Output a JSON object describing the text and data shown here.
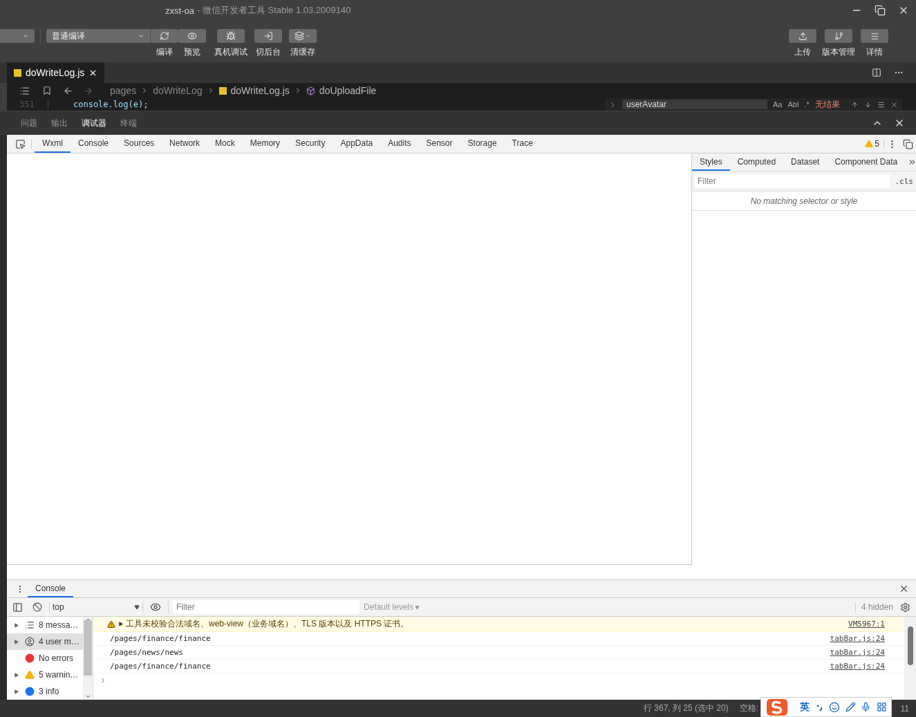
{
  "window": {
    "title": "zxst-oa",
    "subtitle": "- 微信开发者工具 Stable 1.03.2009140"
  },
  "toolbar": {
    "mode_select": "普通编译",
    "left_buttons": [
      {
        "label": "编译"
      },
      {
        "label": "预览"
      },
      {
        "label": "真机调试"
      },
      {
        "label": "切后台"
      },
      {
        "label": "清缓存"
      }
    ],
    "right_buttons": [
      {
        "label": "上传"
      },
      {
        "label": "版本管理"
      },
      {
        "label": "详情"
      }
    ]
  },
  "editor": {
    "tabs": [
      {
        "label": "doWriteLog.js",
        "selected": true
      }
    ],
    "breadcrumb": [
      "pages",
      "doWriteLog",
      "doWriteLog.js",
      "doUploadFile"
    ],
    "line_number": "351",
    "code": "console.log(e);",
    "find": {
      "value": "userAvatar",
      "options": [
        "Aa",
        "Abl",
        ".*"
      ],
      "result": "无结果"
    }
  },
  "panel_tabs": [
    {
      "label": "问题",
      "selected": false
    },
    {
      "label": "输出",
      "selected": false
    },
    {
      "label": "调试器",
      "selected": true
    },
    {
      "label": "终端",
      "selected": false
    }
  ],
  "devtools": {
    "tabs": [
      {
        "label": "Wxml",
        "selected": true
      },
      {
        "label": "Console",
        "selected": false
      },
      {
        "label": "Sources",
        "selected": false
      },
      {
        "label": "Network",
        "selected": false
      },
      {
        "label": "Mock",
        "selected": false
      },
      {
        "label": "Memory",
        "selected": false
      },
      {
        "label": "Security",
        "selected": false
      },
      {
        "label": "AppData",
        "selected": false
      },
      {
        "label": "Audits",
        "selected": false
      },
      {
        "label": "Sensor",
        "selected": false
      },
      {
        "label": "Storage",
        "selected": false
      },
      {
        "label": "Trace",
        "selected": false
      }
    ],
    "warning_count": "5"
  },
  "styles_pane": {
    "tabs": [
      {
        "label": "Styles",
        "selected": true
      },
      {
        "label": "Computed",
        "selected": false
      },
      {
        "label": "Dataset",
        "selected": false
      },
      {
        "label": "Component Data",
        "selected": false
      }
    ],
    "filter_placeholder": "Filter",
    "cls": ".cls",
    "empty": "No matching selector or style"
  },
  "console": {
    "tab": "Console",
    "context": "top",
    "filter_placeholder": "Filter",
    "levels": "Default levels",
    "hidden": "4 hidden",
    "sidebar": [
      {
        "kind": "messages",
        "label": "8 messa…",
        "selected": false
      },
      {
        "kind": "user",
        "label": "4 user m…",
        "selected": true
      },
      {
        "kind": "error",
        "label": "No errors",
        "selected": false
      },
      {
        "kind": "warning",
        "label": "5 warnin…",
        "selected": false
      },
      {
        "kind": "info",
        "label": "3 info",
        "selected": false
      }
    ],
    "messages": [
      {
        "kind": "warning",
        "text": "工具未校验合法域名、web-view（业务域名）、TLS 版本以及 HTTPS 证书。",
        "source": "VM5967:1"
      },
      {
        "kind": "log",
        "text": "/pages/finance/finance",
        "source": "tabBar.js:24"
      },
      {
        "kind": "log",
        "text": "/pages/news/news",
        "source": "tabBar.js:24"
      },
      {
        "kind": "log",
        "text": "/pages/finance/finance",
        "source": "tabBar.js:24"
      }
    ]
  },
  "status_bar": {
    "position": "行 367, 列 25 (选中 20)",
    "indent": "空格:",
    "tail": "11"
  },
  "ime_bar": {
    "language": "英"
  }
}
